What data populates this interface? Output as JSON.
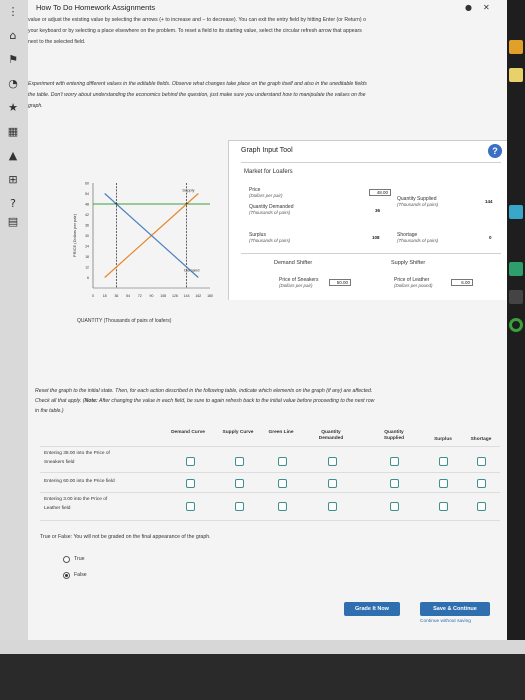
{
  "header": {
    "title": "How To Do Homework Assignments"
  },
  "intro": {
    "line1": "value or adjust the existing value by selecting the arrows (+ to increase and − to decrease). You can exit the entry field by hitting Enter (or Return) o",
    "line2": "your keyboard or by selecting a place elsewhere on the problem. To reset a field to its starting value, select the circular refresh arrow that appears",
    "line3": "next to the selected field."
  },
  "experiment": {
    "line1": "Experiment with entering different values in the editable fields. Observe what changes take place on the graph itself and also in the uneditable fields",
    "line2": "the table. Don't worry about understanding the economics behind the question, just make sure you understand how to manipulate the values on the",
    "line3": "graph."
  },
  "graph_tool": {
    "title": "Graph Input Tool",
    "market_title": "Market for Loafers",
    "price_label": "Price",
    "price_unit": "(Dollars per pair)",
    "price_value": "48.00",
    "qd_label": "Quantity Demanded",
    "qd_unit": "(Thousands of pairs)",
    "qd_value": "36",
    "qs_label": "Quantity Supplied",
    "qs_unit": "(Thousands of pairs)",
    "qs_value": "144",
    "surplus_label": "Surplus",
    "surplus_unit": "(Thousands of pairs)",
    "surplus_value": "108",
    "shortage_label": "Shortage",
    "shortage_unit": "(Thousands of pairs)",
    "shortage_value": "0",
    "demand_shifter": "Demand Shifter",
    "supply_shifter": "Supply Shifter",
    "sneakers_label": "Price of Sneakers",
    "sneakers_unit": "(Dollars per pair)",
    "sneakers_value": "50.00",
    "leather_label": "Price of Leather",
    "leather_unit": "(Dollars per pound)",
    "leather_value": "6.00"
  },
  "chart_data": {
    "type": "line",
    "ylabel": "PRICE (Dollars per pair)",
    "xlabel": "QUANTITY (Thousands of pairs of loafers)",
    "yticks": [
      "60",
      "54",
      "48",
      "42",
      "36",
      "30",
      "24",
      "18",
      "12",
      "6",
      "0"
    ],
    "xticks": [
      "0",
      "18",
      "36",
      "54",
      "72",
      "90",
      "108",
      "126",
      "144",
      "162",
      "180"
    ],
    "xlim": [
      0,
      180
    ],
    "ylim": [
      0,
      60
    ],
    "series": [
      {
        "name": "Supply",
        "color": "#e8872a",
        "points": [
          [
            18,
            6
          ],
          [
            162,
            54
          ]
        ]
      },
      {
        "name": "Demand",
        "color": "#4a7fbf",
        "points": [
          [
            18,
            54
          ],
          [
            162,
            6
          ]
        ]
      }
    ],
    "price_line": {
      "y": 48,
      "color": "#3aa13a"
    },
    "dashed_x": [
      36,
      144
    ]
  },
  "instructions": {
    "line1": "Reset the graph to the initial state. Then, for each action described in the following table, indicate which elements on the graph (if any) are affected.",
    "line2a": "Check all that apply. (",
    "note": "Note:",
    "line2b": " After changing the value in each field, be sure to again refresh back to the initial value before proceeding to the next row",
    "line3": "in the table.)"
  },
  "table": {
    "headers": [
      "Demand Curve",
      "Supply Curve",
      "Green Line",
      "Quantity Demanded",
      "Quantity Supplied",
      "Surplus",
      "Shortage"
    ],
    "rows": [
      {
        "a": "Entering 38.00 into the Price of",
        "b": "Sneakers field"
      },
      {
        "a": "Entering 60.00 into the Price field",
        "b": ""
      },
      {
        "a": "Entering 3.00 into the Price of",
        "b": "Leather field"
      }
    ]
  },
  "truefalse": {
    "question": "True or False: You will not be graded on the final appearance of the graph.",
    "opt_true": "True",
    "opt_false": "False"
  },
  "buttons": {
    "grade": "Grade It Now",
    "save": "Save & Continue",
    "continue": "Continue without saving"
  }
}
